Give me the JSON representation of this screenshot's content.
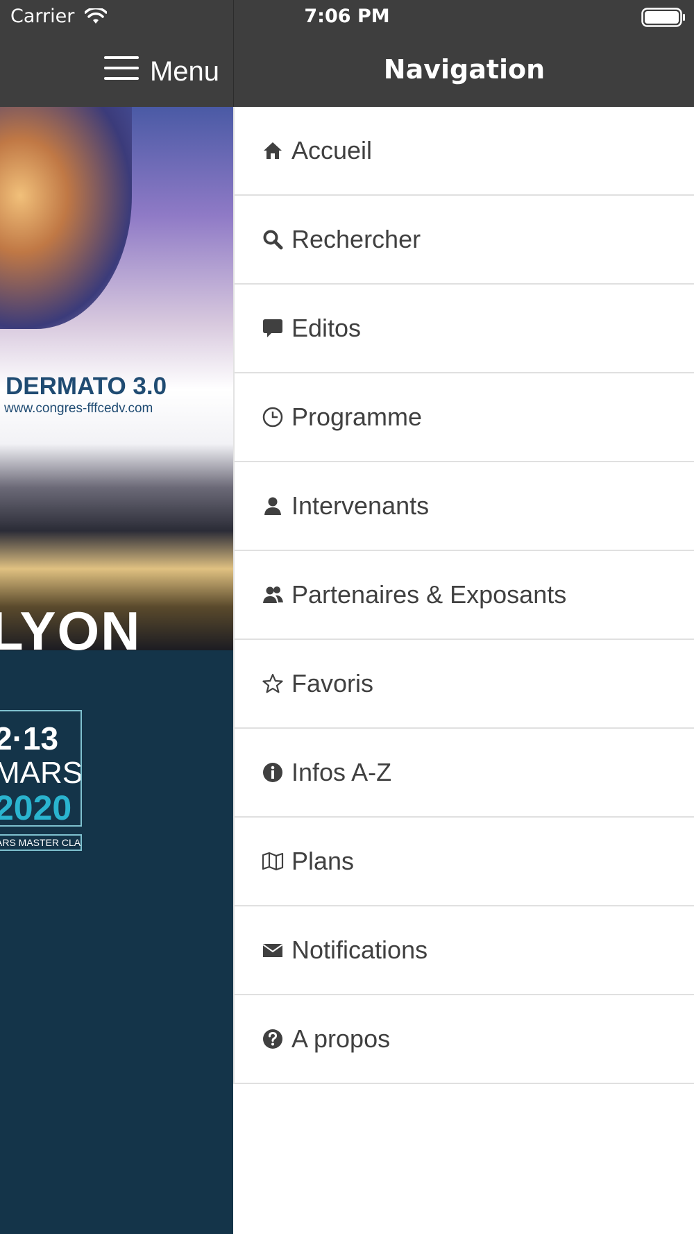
{
  "status_bar": {
    "carrier": "Carrier",
    "time": "7:06 PM"
  },
  "main": {
    "menu_label": "Menu",
    "hero": {
      "title": "DERMATO 3.0",
      "url": "www.congres-fffcedv.com",
      "city": "LYON",
      "date_line1": "2·13",
      "date_line2": "MARS",
      "date_line3": "2020",
      "class_label": "ARS MASTER CLASS"
    }
  },
  "drawer": {
    "title": "Navigation",
    "items": [
      {
        "label": "Accueil",
        "icon": "home-icon"
      },
      {
        "label": "Rechercher",
        "icon": "search-icon"
      },
      {
        "label": "Editos",
        "icon": "speech-bubble-icon"
      },
      {
        "label": "Programme",
        "icon": "clock-icon"
      },
      {
        "label": "Intervenants",
        "icon": "user-icon"
      },
      {
        "label": "Partenaires & Exposants",
        "icon": "users-icon"
      },
      {
        "label": "Favoris",
        "icon": "star-icon"
      },
      {
        "label": "Infos A-Z",
        "icon": "info-icon"
      },
      {
        "label": "Plans",
        "icon": "map-icon"
      },
      {
        "label": "Notifications",
        "icon": "envelope-icon"
      },
      {
        "label": "A propos",
        "icon": "question-icon"
      }
    ]
  },
  "colors": {
    "header": "#3e3e3e",
    "drawer_bg": "#ffffff",
    "text": "#404040",
    "left_bg": "#143449"
  }
}
